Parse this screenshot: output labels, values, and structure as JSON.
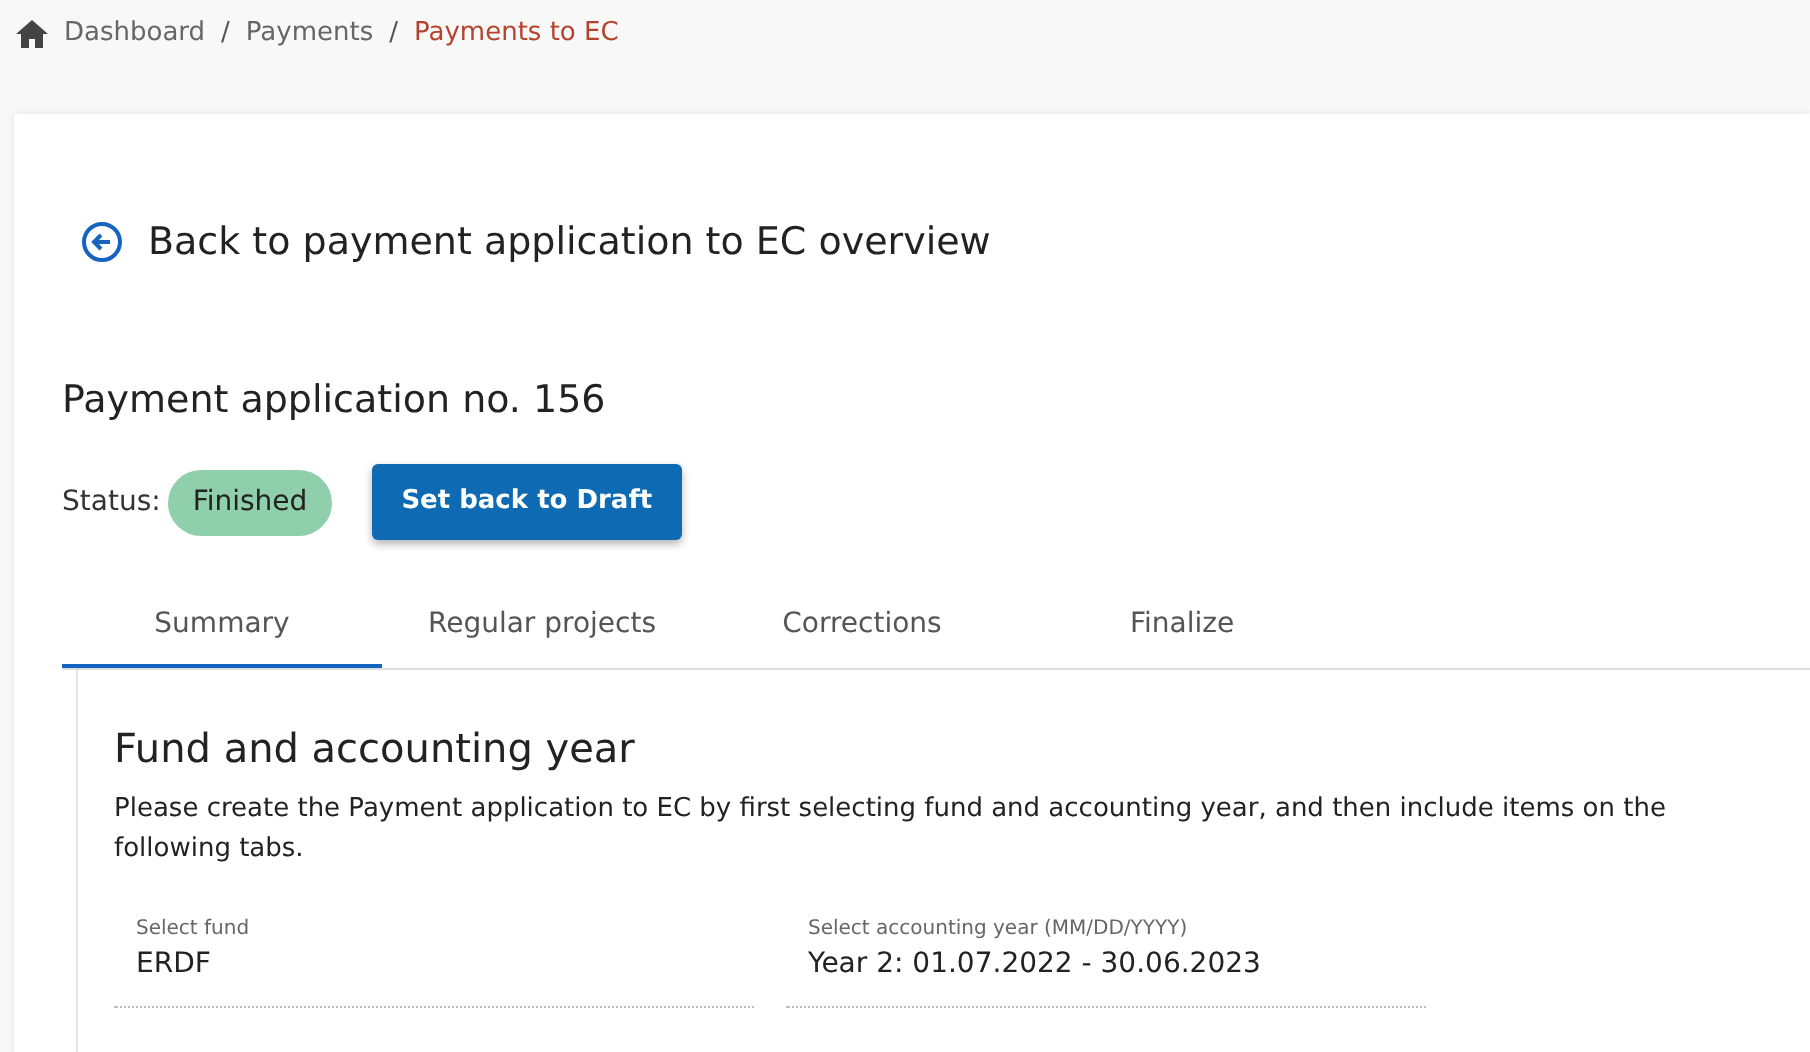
{
  "breadcrumb_separator": "/",
  "breadcrumb": [
    {
      "label": "Dashboard",
      "current": false
    },
    {
      "label": "Payments",
      "current": false
    },
    {
      "label": "Payments to EC",
      "current": true
    }
  ],
  "back_link": "Back to payment application to EC overview",
  "title": "Payment application no. 156",
  "status": {
    "label": "Status:",
    "value": "Finished"
  },
  "action_button": "Set back to Draft",
  "tabs": [
    {
      "label": "Summary",
      "selected": true
    },
    {
      "label": "Regular projects",
      "selected": false
    },
    {
      "label": "Corrections",
      "selected": false
    },
    {
      "label": "Finalize",
      "selected": false
    }
  ],
  "section": {
    "heading": "Fund and accounting year",
    "description": "Please create the Payment application to EC by first selecting fund and accounting year, and then include items on the following tabs.",
    "fields": [
      {
        "label": "Select fund",
        "value": "ERDF"
      },
      {
        "label": "Select accounting year (MM/DD/YYYY)",
        "value": "Year 2: 01.07.2022 - 30.06.2023"
      }
    ]
  }
}
